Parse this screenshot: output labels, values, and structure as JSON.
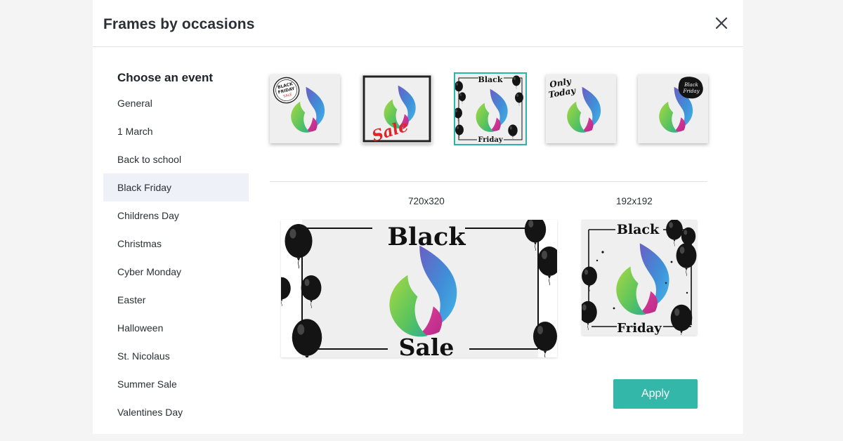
{
  "header": {
    "title": "Frames by occasions"
  },
  "sidebar": {
    "heading": "Choose an event",
    "selected": "Black Friday",
    "items": [
      {
        "label": "General"
      },
      {
        "label": "1 March"
      },
      {
        "label": "Back to school"
      },
      {
        "label": "Black Friday"
      },
      {
        "label": "Childrens Day"
      },
      {
        "label": "Christmas"
      },
      {
        "label": "Cyber Monday"
      },
      {
        "label": "Easter"
      },
      {
        "label": "Halloween"
      },
      {
        "label": "St. Nicolaus"
      },
      {
        "label": "Summer Sale"
      },
      {
        "label": "Valentines Day"
      }
    ]
  },
  "frames": {
    "selected_index": 2,
    "items": [
      {
        "name": "black-friday-stamp-frame",
        "text_lines": [
          "BLACK",
          "FRIDAY",
          "SALE"
        ]
      },
      {
        "name": "sale-border-frame",
        "text": "Sale"
      },
      {
        "name": "black-friday-balloons-frame",
        "top_text": "Black",
        "bottom_text": "Friday"
      },
      {
        "name": "only-today-frame",
        "text_lines": [
          "Only",
          "Today"
        ]
      },
      {
        "name": "black-friday-blob-frame",
        "text_lines": [
          "Black",
          "Friday"
        ]
      }
    ]
  },
  "previews": {
    "wide": {
      "size_label": "720x320",
      "top_text": "Black",
      "bottom_text": "Sale"
    },
    "square": {
      "size_label": "192x192",
      "top_text": "Black",
      "bottom_text": "Friday"
    }
  },
  "actions": {
    "apply_label": "Apply"
  },
  "colors": {
    "accent": "#32b7a8",
    "selected_row": "#eef2f8",
    "selected_border": "#2bb5a8"
  }
}
